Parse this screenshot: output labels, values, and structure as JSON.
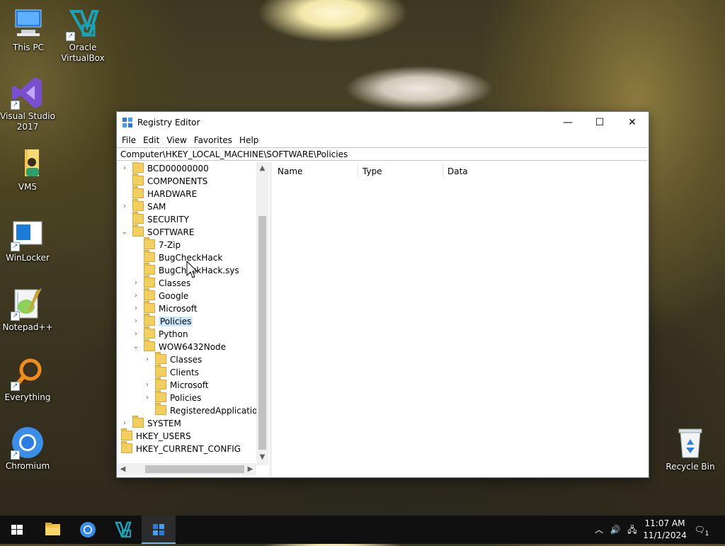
{
  "desktop": {
    "icons": [
      {
        "label": "This PC",
        "icon": "this-pc-icon"
      },
      {
        "label": "Oracle\nVirtualBox",
        "icon": "virtualbox-icon"
      },
      {
        "label": "Visual Studio\n2017",
        "icon": "visual-studio-icon"
      },
      {
        "label": "VM5",
        "icon": "folder-user-icon"
      },
      {
        "label": "WinLocker",
        "icon": "winlocker-icon"
      },
      {
        "label": "Notepad++",
        "icon": "notepadpp-icon"
      },
      {
        "label": "Everything",
        "icon": "everything-search-icon"
      },
      {
        "label": "Chromium",
        "icon": "chromium-icon"
      },
      {
        "label": "Recycle Bin",
        "icon": "recycle-bin-icon"
      }
    ]
  },
  "window": {
    "title": "Registry Editor",
    "controls": {
      "minimize": "—",
      "maximize": "☐",
      "close": "✕"
    },
    "menu": [
      "File",
      "Edit",
      "View",
      "Favorites",
      "Help"
    ],
    "address": "Computer\\HKEY_LOCAL_MACHINE\\SOFTWARE\\Policies",
    "tree": [
      {
        "label": "BCD00000000",
        "level": 1,
        "expander": "›"
      },
      {
        "label": "COMPONENTS",
        "level": 1,
        "expander": ""
      },
      {
        "label": "HARDWARE",
        "level": 1,
        "expander": ""
      },
      {
        "label": "SAM",
        "level": 1,
        "expander": "›"
      },
      {
        "label": "SECURITY",
        "level": 1,
        "expander": ""
      },
      {
        "label": "SOFTWARE",
        "level": 1,
        "expander": "⌄"
      },
      {
        "label": "7-Zip",
        "level": 2,
        "expander": ""
      },
      {
        "label": "BugCheckHack",
        "level": 2,
        "expander": ""
      },
      {
        "label": "BugCheckHack.sys",
        "level": 2,
        "expander": ""
      },
      {
        "label": "Classes",
        "level": 2,
        "expander": "›"
      },
      {
        "label": "Google",
        "level": 2,
        "expander": "›"
      },
      {
        "label": "Microsoft",
        "level": 2,
        "expander": "›"
      },
      {
        "label": "Policies",
        "level": 2,
        "expander": "›",
        "selected": true
      },
      {
        "label": "Python",
        "level": 2,
        "expander": "›"
      },
      {
        "label": "WOW6432Node",
        "level": 2,
        "expander": "⌄"
      },
      {
        "label": "Classes",
        "level": 3,
        "expander": "›"
      },
      {
        "label": "Clients",
        "level": 3,
        "expander": ""
      },
      {
        "label": "Microsoft",
        "level": 3,
        "expander": "›"
      },
      {
        "label": "Policies",
        "level": 3,
        "expander": "›"
      },
      {
        "label": "RegisteredApplications",
        "level": 3,
        "expander": ""
      },
      {
        "label": "SYSTEM",
        "level": 1,
        "expander": "›"
      },
      {
        "label": "HKEY_USERS",
        "level": 0,
        "expander": ""
      },
      {
        "label": "HKEY_CURRENT_CONFIG",
        "level": 0,
        "expander": ""
      }
    ],
    "columns": [
      "Name",
      "Type",
      "Data"
    ]
  },
  "taskbar": {
    "items": [
      "start-icon",
      "file-explorer-icon",
      "chromium-icon",
      "virtualbox-icon",
      "registry-editor-icon"
    ],
    "active": "registry-editor-icon",
    "clock_time": "11:07 AM",
    "clock_date": "11/1/2024",
    "notification_count": "1"
  },
  "colors": {
    "selection": "#cce8ff",
    "folder": "#f3cf61",
    "taskbar": "#101010",
    "accent": "#76b9ed"
  }
}
